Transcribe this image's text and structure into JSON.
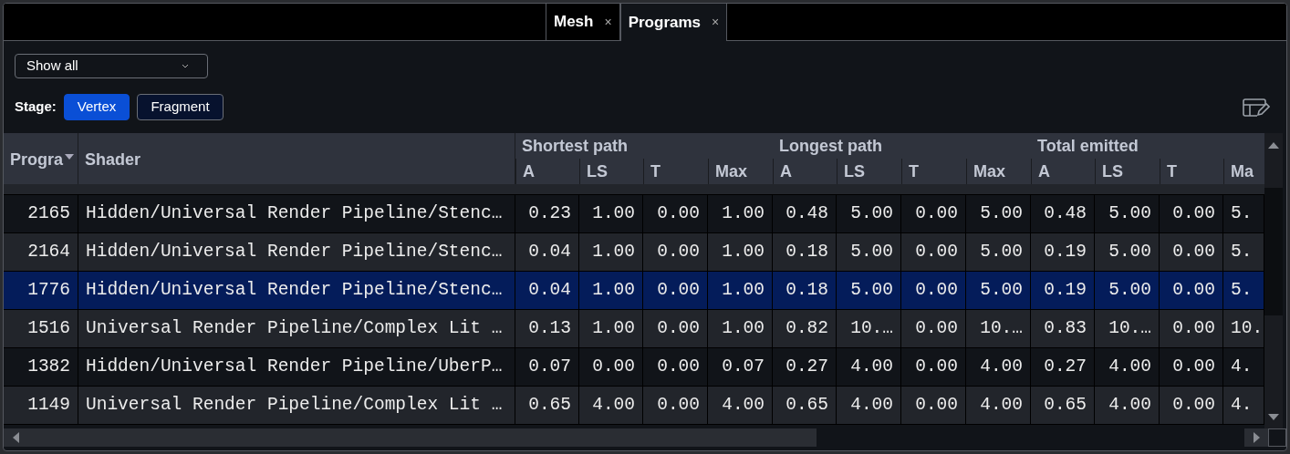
{
  "tabs": [
    {
      "label": "Mesh",
      "selected": false,
      "close": "×"
    },
    {
      "label": "Programs",
      "selected": true,
      "close": "×"
    }
  ],
  "filter": {
    "value": "Show all"
  },
  "stage": {
    "label": "Stage:",
    "options": [
      {
        "label": "Vertex",
        "selected": true
      },
      {
        "label": "Fragment",
        "selected": false
      }
    ]
  },
  "table": {
    "column_groups": [
      {
        "label": "Shortest path"
      },
      {
        "label": "Longest path"
      },
      {
        "label": "Total emitted"
      }
    ],
    "columns": [
      {
        "label": "Progra",
        "sorted": true
      },
      {
        "label": "Shader",
        "sorted": false
      },
      {
        "label": "A",
        "sorted": false
      },
      {
        "label": "LS",
        "sorted": false
      },
      {
        "label": "T",
        "sorted": false
      },
      {
        "label": "Max",
        "sorted": false
      },
      {
        "label": "A",
        "sorted": false
      },
      {
        "label": "LS",
        "sorted": false
      },
      {
        "label": "T",
        "sorted": false
      },
      {
        "label": "Max",
        "sorted": false
      },
      {
        "label": "A",
        "sorted": false
      },
      {
        "label": "LS",
        "sorted": false
      },
      {
        "label": "T",
        "sorted": false
      },
      {
        "label": "Ma",
        "sorted": false
      }
    ],
    "rows": [
      {
        "selected": false,
        "cells": [
          "2165",
          "Hidden/Universal Render Pipeline/Stenc…",
          "0.23",
          "1.00",
          "0.00",
          "1.00",
          "0.48",
          "5.00",
          "0.00",
          "5.00",
          "0.48",
          "5.00",
          "0.00",
          "5."
        ]
      },
      {
        "selected": false,
        "cells": [
          "2164",
          "Hidden/Universal Render Pipeline/Stenc…",
          "0.04",
          "1.00",
          "0.00",
          "1.00",
          "0.18",
          "5.00",
          "0.00",
          "5.00",
          "0.19",
          "5.00",
          "0.00",
          "5."
        ]
      },
      {
        "selected": true,
        "cells": [
          "1776",
          "Hidden/Universal Render Pipeline/Stenc…",
          "0.04",
          "1.00",
          "0.00",
          "1.00",
          "0.18",
          "5.00",
          "0.00",
          "5.00",
          "0.19",
          "5.00",
          "0.00",
          "5."
        ]
      },
      {
        "selected": false,
        "cells": [
          "1516",
          "Universal Render Pipeline/Complex Lit …",
          "0.13",
          "1.00",
          "0.00",
          "1.00",
          "0.82",
          "10.…",
          "0.00",
          "10.…",
          "0.83",
          "10.…",
          "0.00",
          "10."
        ]
      },
      {
        "selected": false,
        "cells": [
          "1382",
          "Hidden/Universal Render Pipeline/UberP…",
          "0.07",
          "0.00",
          "0.00",
          "0.07",
          "0.27",
          "4.00",
          "0.00",
          "4.00",
          "0.27",
          "4.00",
          "0.00",
          "4."
        ]
      },
      {
        "selected": false,
        "cells": [
          "1149",
          "Universal Render Pipeline/Complex Lit …",
          "0.65",
          "4.00",
          "0.00",
          "4.00",
          "0.65",
          "4.00",
          "0.00",
          "4.00",
          "0.65",
          "4.00",
          "0.00",
          "4."
        ]
      }
    ]
  }
}
